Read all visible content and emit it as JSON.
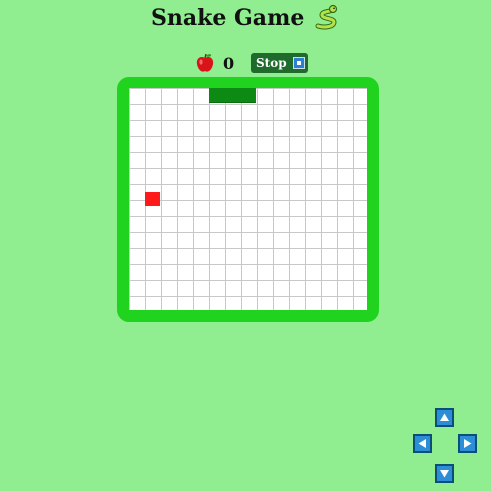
{
  "game": {
    "title": "Snake Game",
    "title_icon": "snake-icon"
  },
  "scorebar": {
    "score_icon": "apple-icon",
    "score": "0",
    "stop_label": "Stop",
    "stop_icon": "stop-square-icon"
  },
  "board": {
    "grid_columns": 15,
    "grid_rows": 14,
    "frame_color": "#1fd31f",
    "snake_color": "#0c8a14",
    "food_color": "#ff1a1a"
  },
  "controls": {
    "up_icon": "arrow-up-icon",
    "left_icon": "arrow-left-icon",
    "right_icon": "arrow-right-icon",
    "down_icon": "arrow-down-icon"
  }
}
